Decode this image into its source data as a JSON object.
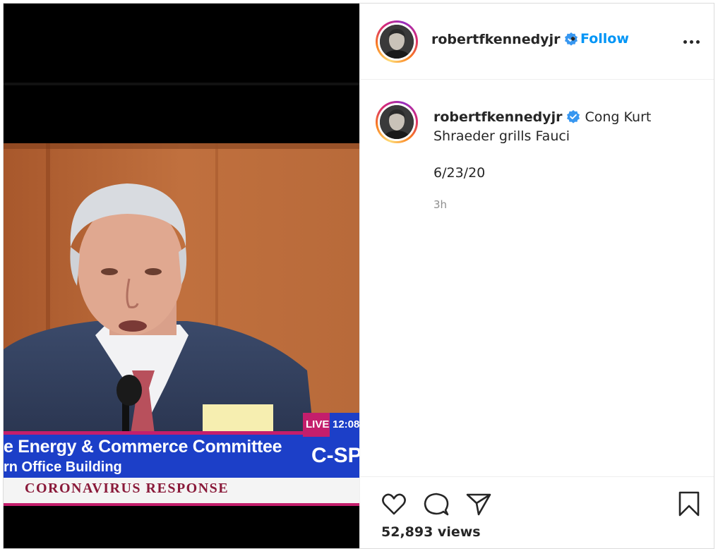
{
  "video": {
    "chyron_title": "e Energy & Commerce Committee",
    "chyron_subtitle": "rn Office Building",
    "chyron_band": "CORONAVIRUS RESPONSE",
    "live_label": "LIVE",
    "live_time": "12:08",
    "network": "C-SP"
  },
  "post": {
    "username": "robertfkennedyjr",
    "separator": "•",
    "follow_label": "Follow",
    "more_icon": "more-horizontal-icon",
    "verified_icon": "verified-badge-icon",
    "caption_text": "Cong Kurt Shraeder grills Fauci",
    "caption_date": "6/23/20",
    "time_ago": "3h",
    "views": "52,893 views"
  },
  "actions": {
    "like_icon": "heart-icon",
    "comment_icon": "comment-icon",
    "share_icon": "share-icon",
    "save_icon": "bookmark-icon"
  },
  "colors": {
    "accent": "#0095f6",
    "chyron_blue": "#1c3fc8",
    "chyron_magenta": "#c41e6c"
  }
}
